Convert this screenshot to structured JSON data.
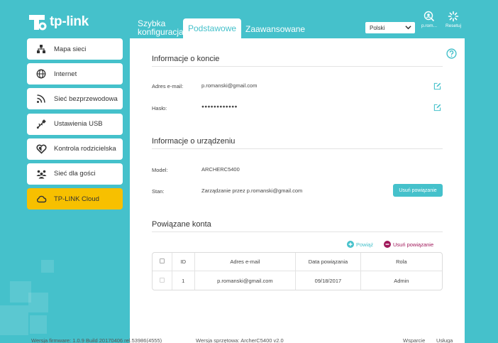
{
  "brand": {
    "name": "tp-link",
    "accent": "#45c1cb",
    "highlight": "#f7c000"
  },
  "nav": {
    "tabs": [
      {
        "label": "Szybka konfiguracja"
      },
      {
        "label": "Podstawowe",
        "active": true
      },
      {
        "label": "Zaawansowane"
      }
    ]
  },
  "header": {
    "language": "Polski",
    "user_label": "p.rom...",
    "reset_label": "Resetuj"
  },
  "sidebar": {
    "items": [
      {
        "label": "Mapa sieci",
        "icon": "network-map-icon"
      },
      {
        "label": "Internet",
        "icon": "globe-icon"
      },
      {
        "label": "Sieć bezprzewodowa",
        "icon": "wifi-icon"
      },
      {
        "label": "Ustawienia USB",
        "icon": "usb-icon"
      },
      {
        "label": "Kontrola rodzicielska",
        "icon": "heart-icon"
      },
      {
        "label": "Sieć dla gości",
        "icon": "guests-icon"
      },
      {
        "label": "TP-LINK Cloud",
        "icon": "cloud-icon",
        "active": true
      }
    ]
  },
  "account": {
    "title": "Informacje o koncie",
    "email_label": "Adres e-mail:",
    "email_value": "p.romanski@gmail.com",
    "password_label": "Hasło:",
    "password_value": "●●●●●●●●●●●●"
  },
  "device": {
    "title": "Informacje o urządzeniu",
    "model_label": "Model:",
    "model_value": "ARCHERC5400",
    "status_label": "Stan:",
    "status_value": "Zarządzanie przez p.romanski@gmail.com",
    "unbind_button": "Usuń powiązanie"
  },
  "linked": {
    "title": "Powiązane konta",
    "add_label": "Powiąż",
    "remove_label": "Usuń powiązanie",
    "columns": [
      "ID",
      "Adres e-mail",
      "Data powiązania",
      "Rola"
    ],
    "rows": [
      {
        "id": "1",
        "email": "p.romanski@gmail.com",
        "date": "09/18/2017",
        "role": "Admin"
      }
    ]
  },
  "footer": {
    "firmware": "Wersja firmware: 1.0.9 Build 20170406 rel.53986(4555)",
    "hardware": "Wersja sprzętowa: ArcherC5400 v2.0",
    "support": "Wsparcie",
    "service": "Usługa"
  }
}
